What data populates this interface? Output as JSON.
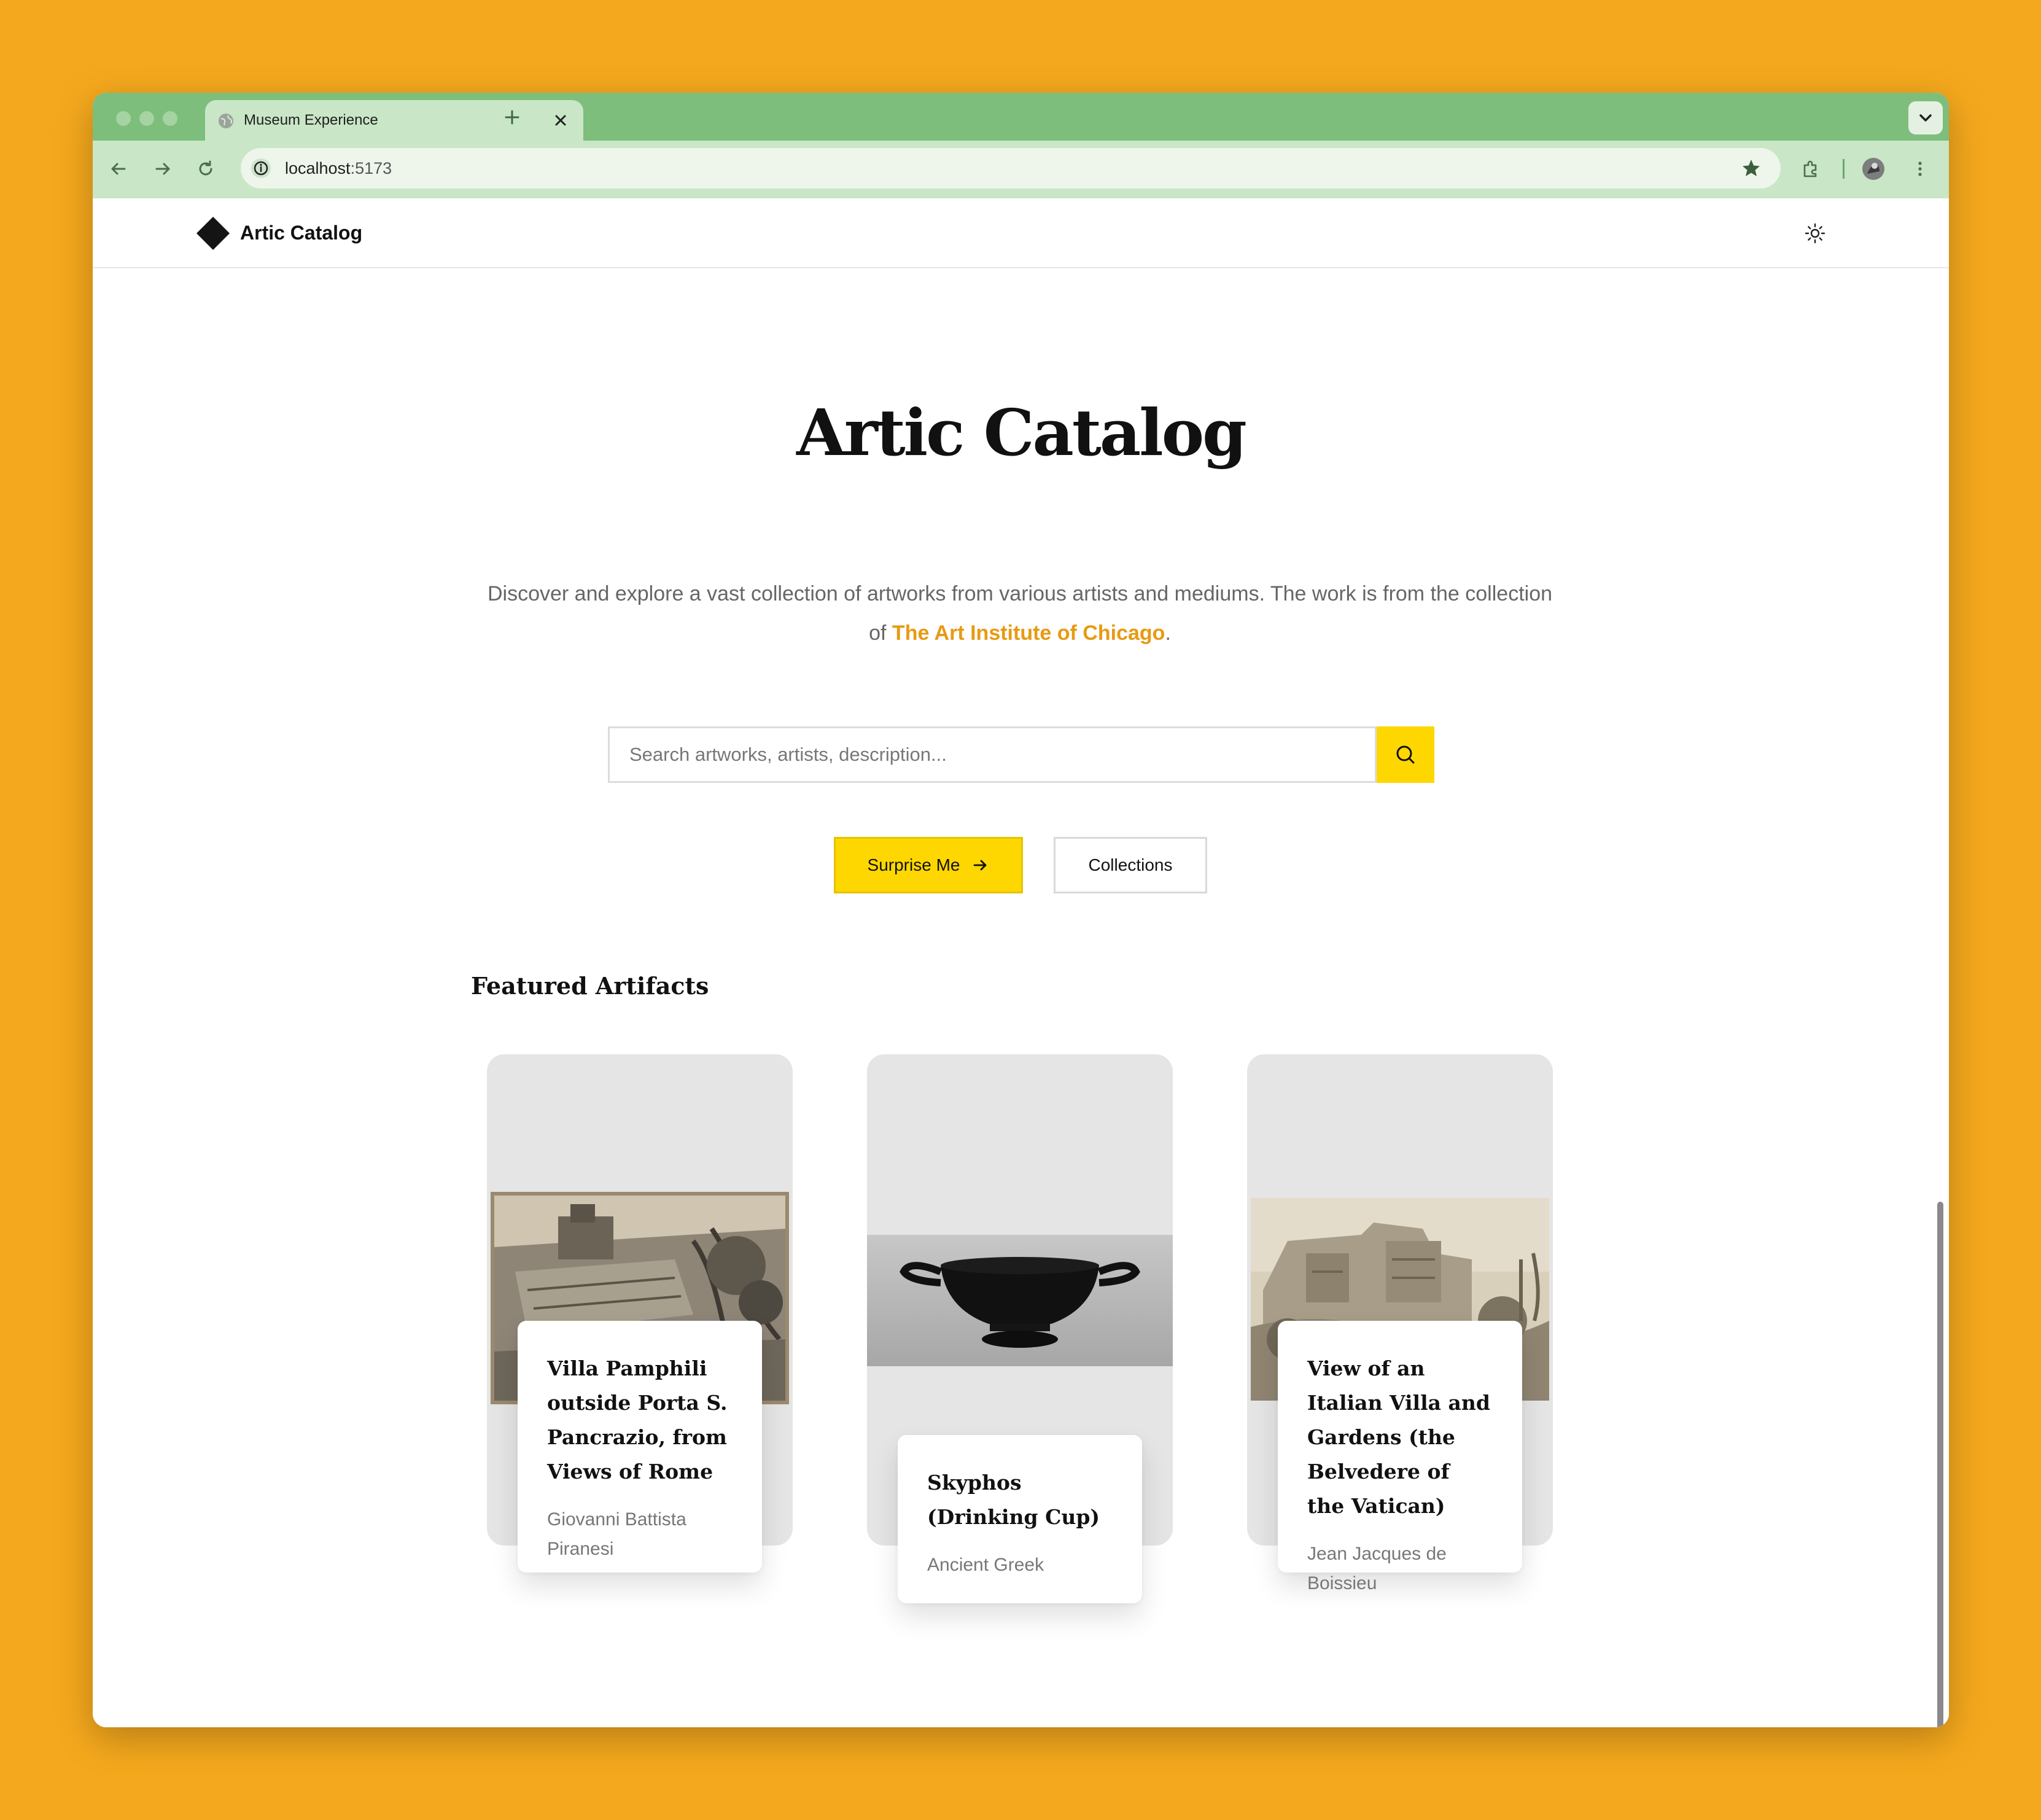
{
  "browser": {
    "tab_title": "Museum Experience",
    "url_host": "localhost",
    "url_port": ":5173"
  },
  "header": {
    "brand": "Artic Catalog"
  },
  "hero": {
    "title": "Artic Catalog",
    "description_before": "Discover and explore a vast collection of artworks from various artists and mediums. The work is from the collection of ",
    "description_link": "The Art Institute of Chicago",
    "description_after": "."
  },
  "search": {
    "placeholder": "Search artworks, artists, description..."
  },
  "actions": {
    "surprise_label": "Surprise Me",
    "collections_label": "Collections"
  },
  "featured": {
    "title": "Featured Artifacts",
    "items": [
      {
        "title": "Villa Pamphili outside Porta S. Pancrazio, from Views of Rome",
        "artist": "Giovanni Battista Piranesi"
      },
      {
        "title": "Skyphos (Drinking Cup)",
        "artist": "Ancient Greek"
      },
      {
        "title": "View of an Italian Villa and Gardens (the Belvedere of the Vatican)",
        "artist": "Jean Jacques de Boissieu"
      }
    ]
  },
  "colors": {
    "background": "#F4A81D",
    "accent": "#FFD700",
    "link": "#E89A12",
    "chrome_green": "#7DBE7C"
  }
}
